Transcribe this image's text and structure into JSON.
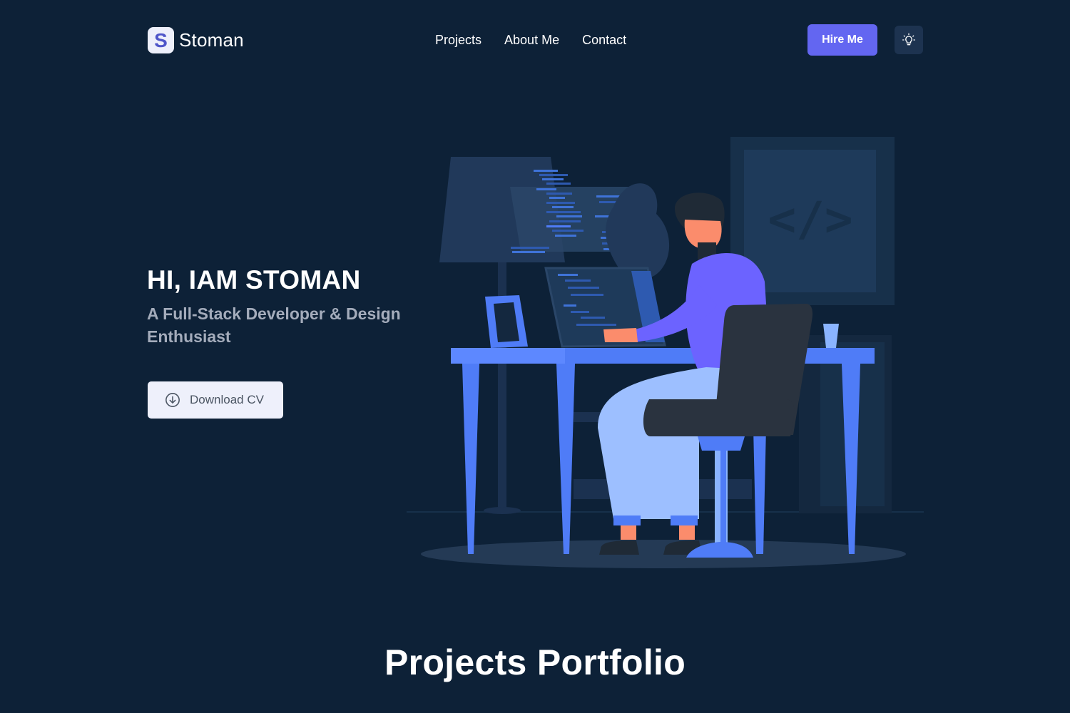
{
  "brand": {
    "logo_letter": "S",
    "name": "Stoman"
  },
  "nav": {
    "items": [
      {
        "label": "Projects"
      },
      {
        "label": "About Me"
      },
      {
        "label": "Contact"
      }
    ],
    "hire_label": "Hire Me",
    "theme_icon": "lightbulb-icon"
  },
  "hero": {
    "title": "HI, IAM STOMAN",
    "subtitle": "A Full-Stack Developer & Design Enthusiast",
    "download_label": "Download CV",
    "download_icon": "download-circle-icon",
    "illustration_code_sign": "</>"
  },
  "projects": {
    "heading": "Projects Portfolio"
  },
  "colors": {
    "background": "#0d2137",
    "accent": "#6366f1",
    "desk": "#4f7cf7",
    "button_light": "#eef0fb"
  }
}
